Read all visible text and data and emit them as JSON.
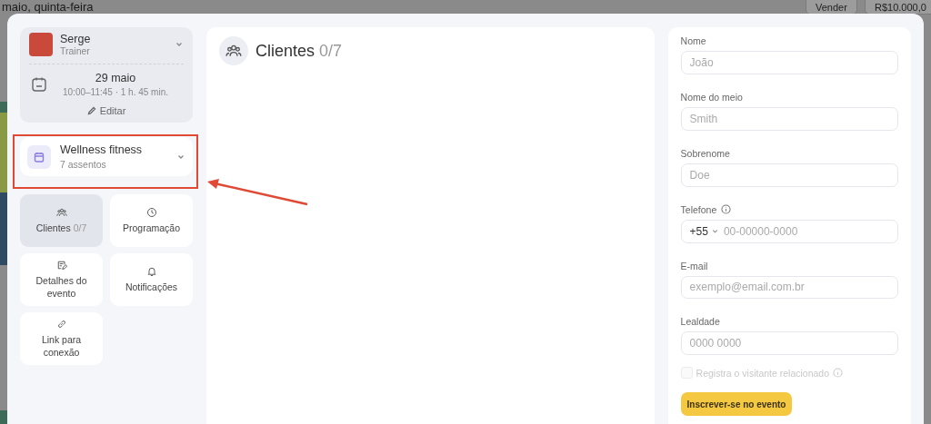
{
  "background": {
    "title": "maio, quinta-feira",
    "buttons": [
      "Vender",
      "R$10.000,0"
    ]
  },
  "trainer": {
    "name": "Serge",
    "role": "Trainer",
    "date": "29 maio",
    "time": "10:00–11:45 · 1 h. 45 min.",
    "edit": "Editar"
  },
  "service": {
    "name": "Wellness fitness",
    "seats": "7 assentos"
  },
  "nav": [
    {
      "label": "Clientes",
      "count": "0/7",
      "selected": true
    },
    {
      "label": "Programação",
      "selected": false
    },
    {
      "label": "Detalhes do evento",
      "selected": false
    },
    {
      "label": "Notificações",
      "selected": false
    },
    {
      "label": "Link para conexão",
      "selected": false
    }
  ],
  "clients_panel": {
    "title": "Clientes",
    "count": "0/7"
  },
  "form": {
    "fields": [
      {
        "kind": "text",
        "label": "Nome",
        "placeholder": "João"
      },
      {
        "kind": "text",
        "label": "Nome do meio",
        "placeholder": "Smith"
      },
      {
        "kind": "text",
        "label": "Sobrenome",
        "placeholder": "Doe"
      },
      {
        "kind": "phone",
        "label": "Telefone",
        "prefix": "+55",
        "placeholder": "00-00000-0000"
      },
      {
        "kind": "text",
        "label": "E-mail",
        "placeholder": "exemplo@email.com.br"
      },
      {
        "kind": "text",
        "label": "Lealdade",
        "placeholder": "0000 0000"
      }
    ],
    "checkbox": {
      "label": "Registra o visitante relacionado",
      "checked": false,
      "disabled": true
    },
    "submit": "Inscrever-se no evento"
  }
}
